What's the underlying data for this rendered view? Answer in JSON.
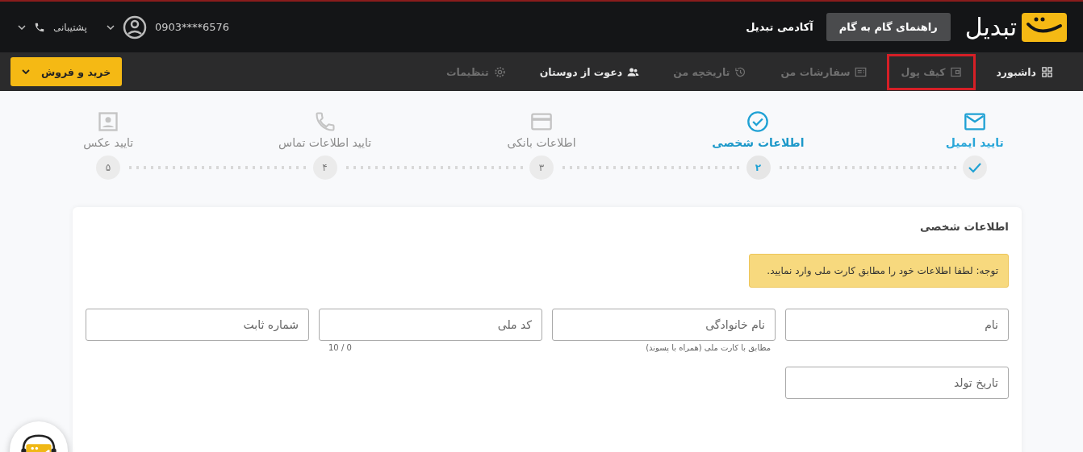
{
  "header": {
    "logo_text": "تبدیل",
    "guide_button": "راهنمای گام به گام",
    "academy_link": "آکادمی تبدیل",
    "phone_masked": "0903****6576",
    "support": "پشتیبانی"
  },
  "nav": [
    {
      "kind": "dashboard",
      "label": "داشبورد",
      "dimmed": false,
      "highlighted": false
    },
    {
      "kind": "wallet",
      "label": "کیف پول",
      "dimmed": true,
      "highlighted": true
    },
    {
      "kind": "orders",
      "label": "سفارشات من",
      "dimmed": true,
      "highlighted": false
    },
    {
      "kind": "history",
      "label": "تاریخچه من",
      "dimmed": true,
      "highlighted": false
    },
    {
      "kind": "invite",
      "label": "دعوت از دوستان",
      "dimmed": false,
      "highlighted": false
    },
    {
      "kind": "settings",
      "label": "تنظیمات",
      "dimmed": true,
      "highlighted": false
    }
  ],
  "trade_button": "خرید و فروش",
  "steps": [
    {
      "kind": "email",
      "label": "تایید ایمیل",
      "completed": true,
      "selected": false
    },
    {
      "kind": "personal",
      "label": "اطلاعات شخصی",
      "completed": false,
      "selected": true,
      "number": "۲"
    },
    {
      "kind": "bank",
      "label": "اطلاعات بانکی",
      "completed": false,
      "selected": false,
      "number": "۳"
    },
    {
      "kind": "contact",
      "label": "تایید اطلاعات تماس",
      "completed": false,
      "selected": false,
      "number": "۴"
    },
    {
      "kind": "photo",
      "label": "تایید عکس",
      "completed": false,
      "selected": false,
      "number": "۵"
    }
  ],
  "card": {
    "title": "اطلاعات شخصی",
    "notice": "توجه: لطفا اطلاعات خود را مطابق کارت ملی وارد نمایید.",
    "fields": [
      {
        "placeholder": "نام"
      },
      {
        "placeholder": "نام خانوادگی",
        "hint": "مطابق با کارت ملی (همراه با پسوند)"
      },
      {
        "placeholder": "کد ملی",
        "counter": "10 / 0"
      },
      {
        "placeholder": "شماره ثابت"
      },
      {
        "placeholder": "تاریخ تولد"
      }
    ]
  }
}
